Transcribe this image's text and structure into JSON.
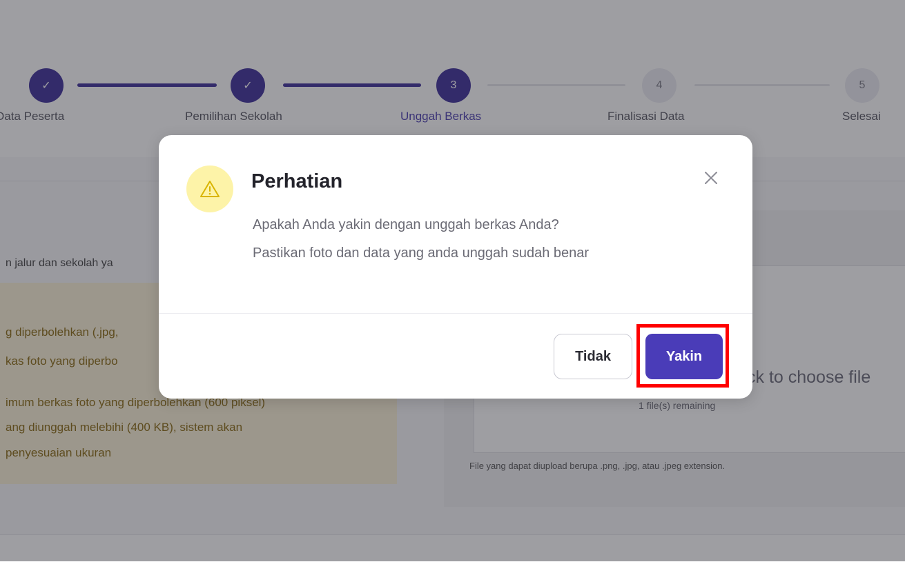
{
  "stepper": {
    "steps": [
      {
        "label": "Data Peserta",
        "state": "done",
        "marker": "✓"
      },
      {
        "label": "Pemilihan Sekolah",
        "state": "done",
        "marker": "✓"
      },
      {
        "label": "Unggah Berkas",
        "state": "active",
        "marker": "3"
      },
      {
        "label": "Finalisasi Data",
        "state": "pending",
        "marker": "4"
      },
      {
        "label": "Selesai",
        "state": "pending",
        "marker": "5"
      }
    ]
  },
  "background": {
    "intro": "n jalur dan sekolah ya",
    "info_lines": [
      "g diperbolehkan (.jpg,",
      "kas foto yang diperbo",
      "imum berkas foto yang diperbolehkan (600 piksel)",
      "ang diunggah melebihi (400 KB), sistem akan",
      "penyesuaian ukuran"
    ],
    "upload_title": "ck to choose file",
    "upload_remaining": "1 file(s) remaining",
    "upload_hint": "File yang dapat diupload berupa .png, .jpg, atau .jpeg extension."
  },
  "modal": {
    "title": "Perhatian",
    "message_line1": "Apakah Anda yakin dengan unggah berkas Anda?",
    "message_line2": "Pastikan foto dan data yang anda unggah sudah benar",
    "cancel_label": "Tidak",
    "confirm_label": "Yakin",
    "icon": "warning-triangle-icon",
    "close_icon": "close-icon"
  },
  "colors": {
    "primary": "#4a3cb8",
    "step_done": "#3d2f9a",
    "warning_bg": "#fdf3a8",
    "warning_icon": "#d9b400",
    "highlight": "#ff0000"
  }
}
